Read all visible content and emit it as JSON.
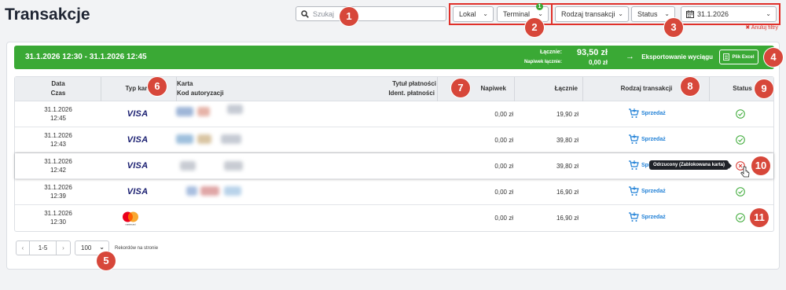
{
  "page": {
    "title": "Transakcje"
  },
  "search": {
    "placeholder": "Szukaj"
  },
  "filters": {
    "lokal": "Lokal",
    "terminal": "Terminal",
    "terminal_count": "1",
    "rodzaj": "Rodzaj transakcji",
    "status": "Status",
    "date": "31.1.2026",
    "clear": "✖ Anuluj filtry"
  },
  "summary": {
    "range": "31.1.2026 12:30 - 31.1.2026 12:45",
    "total_label": "Łącznie:",
    "tip_label": "Napiwek łącznie:",
    "total_value": "93,50 zł",
    "tip_value": "0,00 zł",
    "export_label": "Eksportowanie wyciągu",
    "excel_label": "Plik Excel"
  },
  "table": {
    "headers": {
      "date": "Data",
      "time": "Czas",
      "card_type": "Typ karty",
      "card": "Karta",
      "auth": "Kod autoryzacji",
      "title": "Tytuł płatności",
      "ident": "Ident. płatności",
      "tip": "Napiwek",
      "total": "Łącznie",
      "type": "Rodzaj transakcji",
      "status": "Status"
    },
    "rows": [
      {
        "date": "31.1.2026",
        "time": "12:45",
        "card": "VISA",
        "tip": "0,00 zł",
        "total": "19,90 zł",
        "type": "Sprzedaż",
        "status": "ok"
      },
      {
        "date": "31.1.2026",
        "time": "12:43",
        "card": "VISA",
        "tip": "0,00 zł",
        "total": "39,80 zł",
        "type": "Sprzedaż",
        "status": "ok"
      },
      {
        "date": "31.1.2026",
        "time": "12:42",
        "card": "VISA",
        "tip": "0,00 zł",
        "total": "39,80 zł",
        "type": "Spr",
        "status": "rejected"
      },
      {
        "date": "31.1.2026",
        "time": "12:39",
        "card": "VISA",
        "tip": "0,00 zł",
        "total": "16,90 zł",
        "type": "Sprzedaż",
        "status": "ok"
      },
      {
        "date": "31.1.2026",
        "time": "12:30",
        "card": "mastercard",
        "tip": "0,00 zł",
        "total": "16,90 zł",
        "type": "Sprzedaż",
        "status": "ok"
      }
    ],
    "tooltip": "Odrzucony (Zablokowana karta)"
  },
  "pagination": {
    "prev": "‹",
    "range": "1-5",
    "next": "›",
    "per_page": "100",
    "per_page_label": "Rekordów na stronie"
  },
  "annotations": [
    "1",
    "2",
    "3",
    "4",
    "5",
    "6",
    "7",
    "8",
    "9",
    "10",
    "11"
  ],
  "colors": {
    "green": "#3aa935",
    "red": "#d7473a",
    "link": "#1e7fd6",
    "visa": "#1a1f71"
  }
}
